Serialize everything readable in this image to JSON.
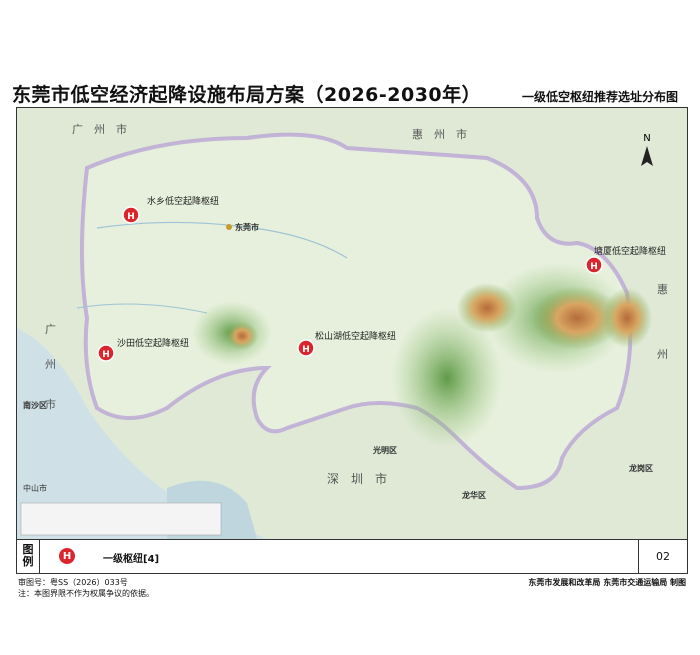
{
  "header": {
    "title": "东莞市低空经济起降设施布局方案（2026-2030年）",
    "subtitle": "一级低空枢纽推荐选址分布图"
  },
  "map": {
    "north_label": "N",
    "cities": [
      "广　州　市",
      "惠　州　市",
      "惠",
      "州",
      "广",
      "州",
      "市",
      "深　圳　市",
      "东莞市"
    ],
    "districts": [
      "南沙区",
      "光明区",
      "龙华区",
      "龙岗区",
      "中山市"
    ],
    "hubs": [
      "水乡低空起降枢纽",
      "松山湖低空起降枢纽",
      "沙田低空起降枢纽",
      "塘厦低空起降枢纽"
    ],
    "hub_glyph": "H",
    "colors": {
      "water": "#cfe3ea",
      "land": "#e3efd9",
      "hill": "#8fbf6e",
      "mountain": "#c9894c",
      "boundary": "#b49ad6",
      "hub": "#d9252b"
    }
  },
  "legend": {
    "label_top": "图",
    "label_bottom": "例",
    "item": "一级枢纽[4]",
    "page": "02"
  },
  "footer": {
    "approval": "审图号：粤SS（2026）033号",
    "note": "注：本图界限不作为权属争议的依据。",
    "agencies": "东莞市发展和改革局  东莞市交通运输局  制图"
  }
}
